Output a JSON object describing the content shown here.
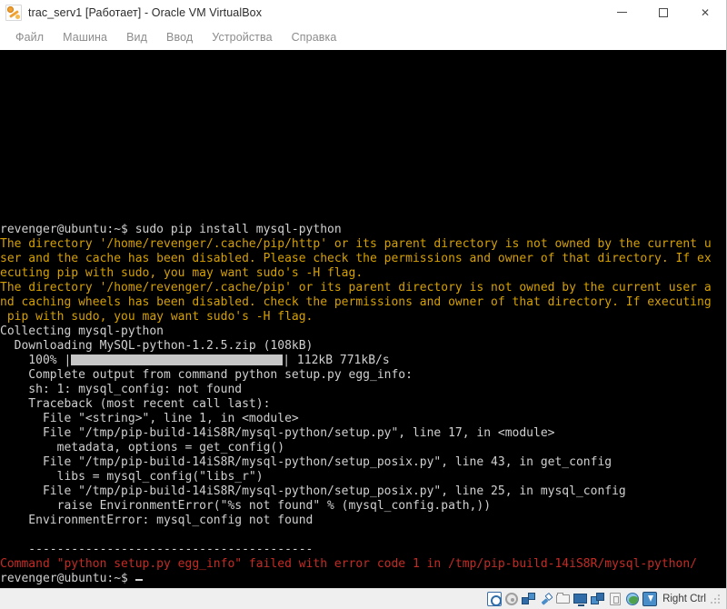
{
  "window": {
    "title": "trac_serv1 [Работает] - Oracle VM VirtualBox",
    "app_icon": "virtualbox-icon",
    "controls": {
      "minimize": "minimize-icon",
      "maximize": "maximize-icon",
      "close": "✕"
    }
  },
  "menubar": {
    "items": [
      {
        "label": "Файл"
      },
      {
        "label": "Машина"
      },
      {
        "label": "Вид"
      },
      {
        "label": "Ввод"
      },
      {
        "label": "Устройства"
      },
      {
        "label": "Справка"
      }
    ]
  },
  "terminal": {
    "colors": {
      "background": "#000000",
      "default_text": "#d0d0d0",
      "warning_text": "#d5a000",
      "error_text": "#c32b25",
      "progress_fill": "#c6c6c6"
    },
    "prompt": "revenger@ubuntu:~$",
    "command": "sudo pip install mysql-python",
    "lines": [
      {
        "color": "white",
        "text": "revenger@ubuntu:~$ sudo pip install mysql-python"
      },
      {
        "color": "yellow",
        "text": "The directory '/home/revenger/.cache/pip/http' or its parent directory is not owned by the current u"
      },
      {
        "color": "yellow",
        "text": "ser and the cache has been disabled. Please check the permissions and owner of that directory. If ex"
      },
      {
        "color": "yellow",
        "text": "ecuting pip with sudo, you may want sudo's -H flag."
      },
      {
        "color": "yellow",
        "text": "The directory '/home/revenger/.cache/pip' or its parent directory is not owned by the current user a"
      },
      {
        "color": "yellow",
        "text": "nd caching wheels has been disabled. check the permissions and owner of that directory. If executing"
      },
      {
        "color": "yellow",
        "text": " pip with sudo, you may want sudo's -H flag."
      },
      {
        "color": "white",
        "text": "Collecting mysql-python"
      },
      {
        "color": "white",
        "text": "  Downloading MySQL-python-1.2.5.zip (108kB)"
      },
      {
        "color": "white",
        "text": "PROGRESS"
      },
      {
        "color": "white",
        "text": "    Complete output from command python setup.py egg_info:"
      },
      {
        "color": "white",
        "text": "    sh: 1: mysql_config: not found"
      },
      {
        "color": "white",
        "text": "    Traceback (most recent call last):"
      },
      {
        "color": "white",
        "text": "      File \"<string>\", line 1, in <module>"
      },
      {
        "color": "white",
        "text": "      File \"/tmp/pip-build-14iS8R/mysql-python/setup.py\", line 17, in <module>"
      },
      {
        "color": "white",
        "text": "        metadata, options = get_config()"
      },
      {
        "color": "white",
        "text": "      File \"/tmp/pip-build-14iS8R/mysql-python/setup_posix.py\", line 43, in get_config"
      },
      {
        "color": "white",
        "text": "        libs = mysql_config(\"libs_r\")"
      },
      {
        "color": "white",
        "text": "      File \"/tmp/pip-build-14iS8R/mysql-python/setup_posix.py\", line 25, in mysql_config"
      },
      {
        "color": "white",
        "text": "        raise EnvironmentError(\"%s not found\" % (mysql_config.path,))"
      },
      {
        "color": "white",
        "text": "    EnvironmentError: mysql_config not found"
      },
      {
        "color": "white",
        "text": "    "
      },
      {
        "color": "white",
        "text": "    ----------------------------------------"
      },
      {
        "color": "red",
        "text": "Command \"python setup.py egg_info\" failed with error code 1 in /tmp/pip-build-14iS8R/mysql-python/"
      },
      {
        "color": "white",
        "text": "revenger@ubuntu:~$ CURSOR"
      }
    ],
    "progress": {
      "prefix": "    100% |",
      "suffix": "| 112kB 771kB/s",
      "percent": "100%",
      "downloaded": "112kB",
      "speed": "771kB/s"
    }
  },
  "statusbar": {
    "icons": [
      {
        "name": "hard-disk-icon"
      },
      {
        "name": "optical-disk-icon"
      },
      {
        "name": "network-icon"
      },
      {
        "name": "usb-icon"
      },
      {
        "name": "shared-folders-icon"
      },
      {
        "name": "display-icon"
      },
      {
        "name": "remote-display-icon"
      },
      {
        "name": "cpu-icon"
      },
      {
        "name": "globe-icon"
      },
      {
        "name": "host-key-capture-icon"
      }
    ],
    "host_key_label": "Right Ctrl"
  }
}
